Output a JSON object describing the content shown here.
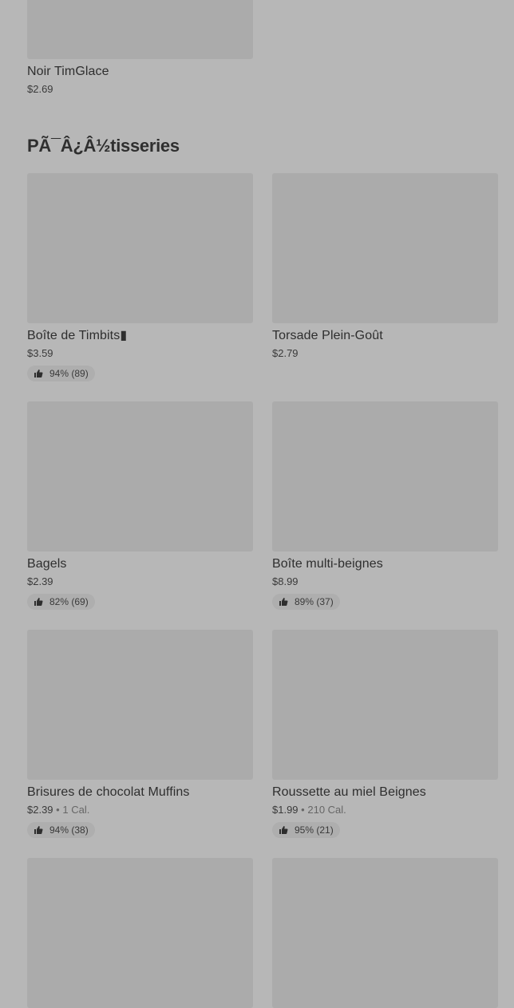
{
  "top_item": {
    "name": "Noir TimGlace",
    "price": "$2.69"
  },
  "section": {
    "title": "PÃ¯Â¿Â½tisseries"
  },
  "items": [
    {
      "name": "Boîte de Timbits▮",
      "price": "$3.59",
      "calories": "",
      "rating": "94% (89)"
    },
    {
      "name": "Torsade Plein-Goût",
      "price": "$2.79",
      "calories": "",
      "rating": ""
    },
    {
      "name": "Bagels",
      "price": "$2.39",
      "calories": "",
      "rating": "82% (69)"
    },
    {
      "name": "Boîte multi-beignes",
      "price": "$8.99",
      "calories": "",
      "rating": "89% (37)"
    },
    {
      "name": "Brisures de chocolat Muffins",
      "price": "$2.39",
      "calories": "1 Cal.",
      "rating": "94% (38)"
    },
    {
      "name": "Roussette au miel Beignes",
      "price": "$1.99",
      "calories": "210 Cal.",
      "rating": "95% (21)"
    },
    {
      "name": "",
      "price": "",
      "calories": "",
      "rating": ""
    },
    {
      "name": "",
      "price": "",
      "calories": "",
      "rating": ""
    }
  ],
  "icons": {
    "rating": "thumbs-up-icon"
  }
}
